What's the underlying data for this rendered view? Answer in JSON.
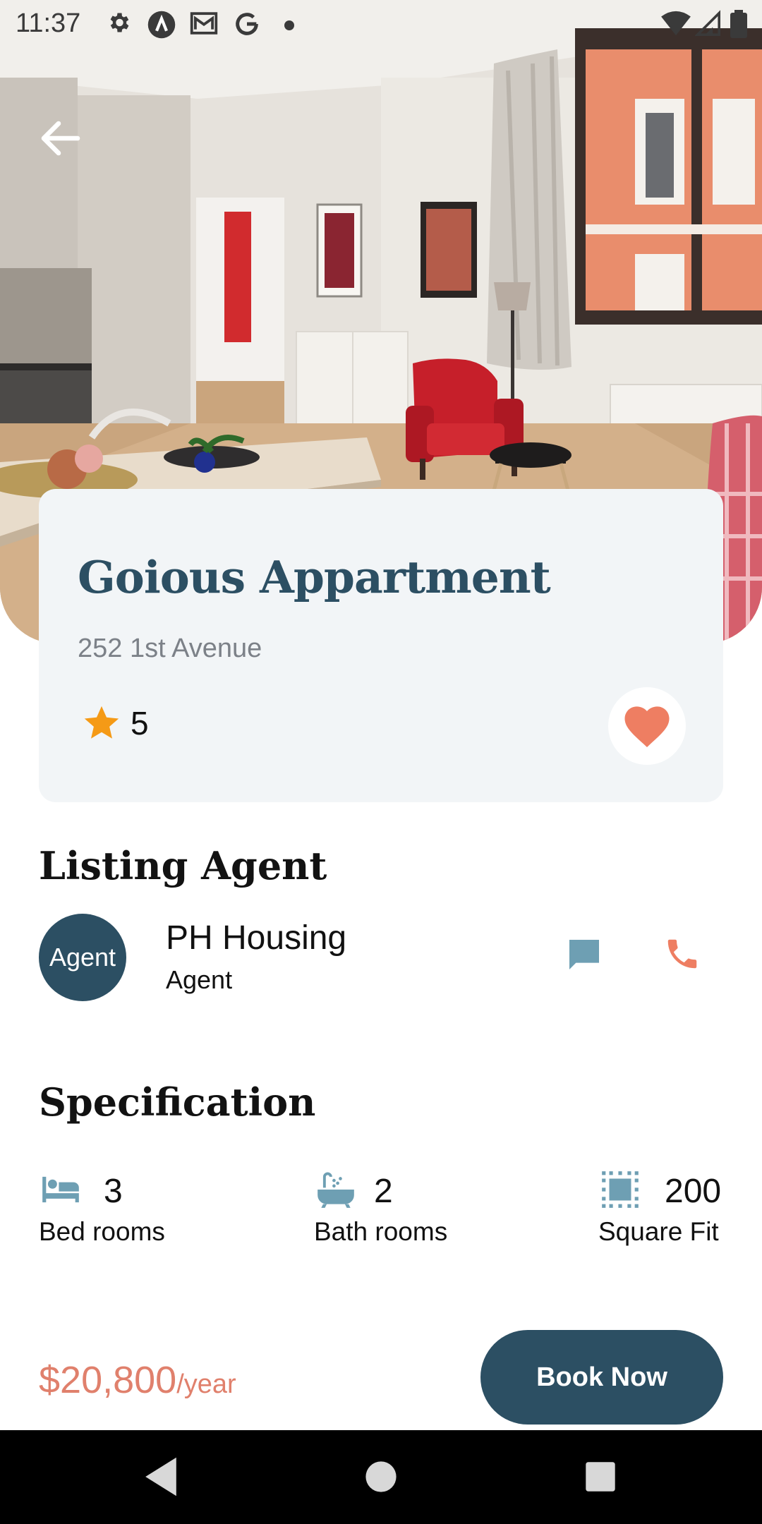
{
  "status_bar": {
    "time": "11:37",
    "icons": [
      "gear-icon",
      "app-a-icon",
      "mail-icon",
      "google-icon",
      "dot-icon",
      "wifi-icon",
      "signal-icon",
      "battery-icon"
    ]
  },
  "listing": {
    "title": "Goious Appartment",
    "address": "252 1st Avenue",
    "rating": "5",
    "favorite": true
  },
  "agent_section": {
    "heading": "Listing Agent",
    "avatar_text": "Agent",
    "name": "PH Housing",
    "role": "Agent"
  },
  "specification": {
    "heading": "Specification",
    "items": [
      {
        "icon": "bed-icon",
        "value": "3",
        "label": "Bed rooms"
      },
      {
        "icon": "bathtub-icon",
        "value": "2",
        "label": "Bath rooms"
      },
      {
        "icon": "square-area-icon",
        "value": "200",
        "label": "Square Fit"
      }
    ]
  },
  "booking": {
    "price": "$20,800",
    "unit": "/year",
    "button_label": "Book Now"
  },
  "colors": {
    "primary": "#2c4f63",
    "accent": "#e0806c",
    "icon_muted": "#6e9fb3",
    "card_bg": "#f2f5f7",
    "star": "#f59a16"
  }
}
